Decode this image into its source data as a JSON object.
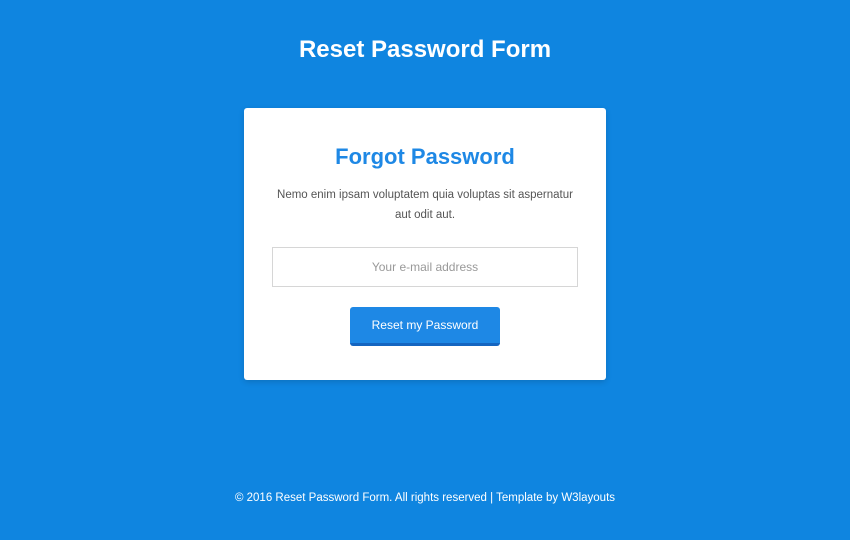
{
  "page": {
    "title": "Reset Password Form"
  },
  "card": {
    "title": "Forgot Password",
    "description": "Nemo enim ipsam voluptatem quia voluptas sit aspernatur aut odit aut.",
    "email_placeholder": "Your e-mail address",
    "submit_label": "Reset my Password"
  },
  "footer": {
    "copyright": "© 2016 Reset Password Form. All rights reserved | Template by ",
    "link_text": "W3layouts"
  }
}
